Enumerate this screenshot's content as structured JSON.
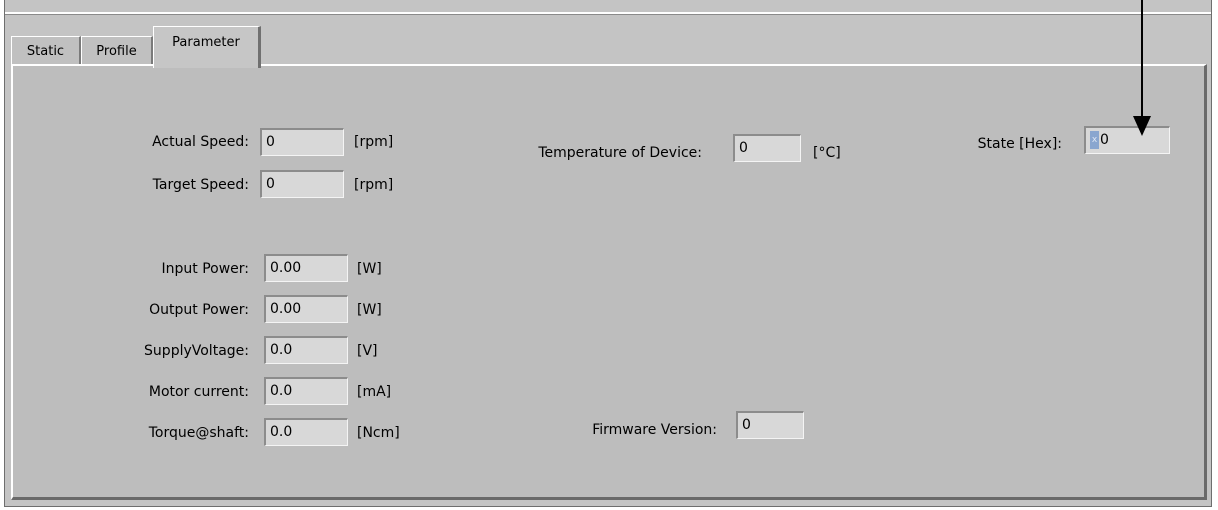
{
  "tabs": [
    {
      "label": "Static"
    },
    {
      "label": "Profile"
    },
    {
      "label": "Parameter"
    }
  ],
  "fields": {
    "actual_speed": {
      "label": "Actual Speed:",
      "value": "0",
      "unit": "[rpm]"
    },
    "target_speed": {
      "label": "Target Speed:",
      "value": "0",
      "unit": "[rpm]"
    },
    "input_power": {
      "label": "Input Power:",
      "value": "0.00",
      "unit": "[W]"
    },
    "output_power": {
      "label": "Output Power:",
      "value": "0.00",
      "unit": "[W]"
    },
    "supply_voltage": {
      "label": "SupplyVoltage:",
      "value": "0.0",
      "unit": "[V]"
    },
    "motor_current": {
      "label": "Motor current:",
      "value": "0.0",
      "unit": "[mA]"
    },
    "torque": {
      "label": "Torque@shaft:",
      "value": "0.0",
      "unit": "[Ncm]"
    },
    "temperature": {
      "label": "Temperature of Device:",
      "value": "0",
      "unit": "[°C]"
    },
    "firmware": {
      "label": "Firmware Version:",
      "value": "0"
    },
    "state": {
      "label": "State [Hex]:",
      "prefix": "x",
      "value": "0"
    }
  }
}
